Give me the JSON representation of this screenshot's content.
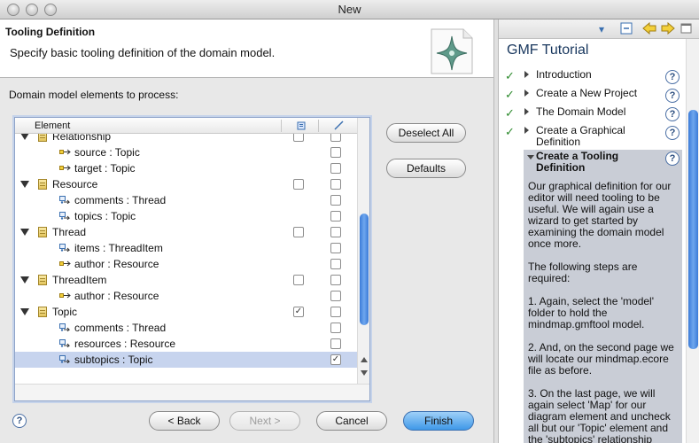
{
  "window": {
    "title": "New"
  },
  "banner": {
    "title": "Tooling Definition",
    "description": "Specify basic tooling definition of the domain model."
  },
  "section_label": "Domain model elements to process:",
  "table": {
    "header": {
      "element": "Element"
    },
    "rows": [
      {
        "kind": "class",
        "label": "Relationship",
        "c1": false,
        "c2": false,
        "partial": true
      },
      {
        "kind": "attr",
        "label": "source : Topic",
        "c2": false
      },
      {
        "kind": "attr",
        "label": "target : Topic",
        "c2": false
      },
      {
        "kind": "class",
        "label": "Resource",
        "c1": false,
        "c2": false
      },
      {
        "kind": "ref",
        "label": "comments : Thread",
        "c2": false
      },
      {
        "kind": "ref",
        "label": "topics : Topic",
        "c2": false
      },
      {
        "kind": "class",
        "label": "Thread",
        "c1": false,
        "c2": false
      },
      {
        "kind": "ref",
        "label": "items : ThreadItem",
        "c2": false
      },
      {
        "kind": "attr",
        "label": "author : Resource",
        "c2": false
      },
      {
        "kind": "class",
        "label": "ThreadItem",
        "c1": false,
        "c2": false
      },
      {
        "kind": "attr",
        "label": "author : Resource",
        "c2": false
      },
      {
        "kind": "class",
        "label": "Topic",
        "c1": true,
        "c2": false
      },
      {
        "kind": "ref",
        "label": "comments : Thread",
        "c2": false
      },
      {
        "kind": "ref",
        "label": "resources : Resource",
        "c2": false
      },
      {
        "kind": "ref",
        "label": "subtopics : Topic",
        "c2": true,
        "selected": true
      }
    ]
  },
  "buttons": {
    "deselect_all": "Deselect All",
    "defaults": "Defaults",
    "back": "< Back",
    "next": "Next >",
    "cancel": "Cancel",
    "finish": "Finish"
  },
  "cheatsheet": {
    "title": "GMF Tutorial",
    "items": [
      {
        "label": "Introduction",
        "done": true
      },
      {
        "label": "Create a New Project",
        "done": true
      },
      {
        "label": "The Domain Model",
        "done": true
      },
      {
        "label": "Create a Graphical Definition",
        "done": true
      }
    ],
    "active": {
      "title": "Create a Tooling Definition",
      "body": "Our graphical definition for our editor will need tooling to be useful. We will again use a wizard to get started by examining the domain model once more.\n\nThe following steps are required:\n\n1. Again, select the 'model' folder to hold the mindmap.gmftool model.\n\n2. And, on the second page we will locate our mindmap.ecore file as before.\n\n3. On the last page, we will again select 'Map' for our diagram element and uncheck all but our 'Topic' element and the 'subtopics' relationship"
    }
  },
  "colors": {
    "accent": "#3f98e8",
    "selection": "#c7d4ee",
    "check": "#2e8b2e"
  }
}
